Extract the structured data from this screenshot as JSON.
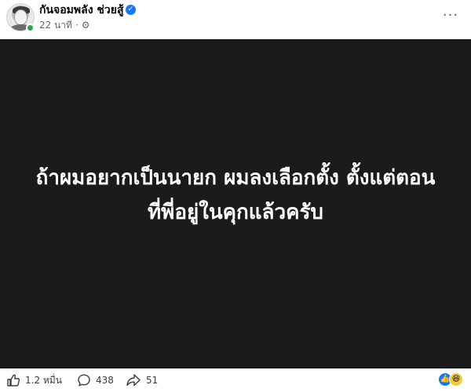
{
  "post": {
    "page_name": "กันจอมพลัง ช่วยสู้",
    "verified_icon": "verified-badge-icon",
    "timestamp": "22 นาที",
    "separator": "·",
    "visibility_icon": "gear-icon",
    "more_icon": "more-horizontal-icon",
    "text_lines": [
      "ถ้าผมอยากเป็นนายก ผมลงเลือกตั้ง ตั้งแต่ตอน",
      "ที่พี่อยู่ในคุกแล้วครับ"
    ]
  },
  "footer": {
    "likes": "1.2 หมื่น",
    "comments": "438",
    "shares": "51"
  },
  "colors": {
    "image_bg": "#1b1b1b",
    "verified_blue": "#1877f2",
    "online_green": "#31a24c",
    "meta_gray": "#65676b"
  }
}
